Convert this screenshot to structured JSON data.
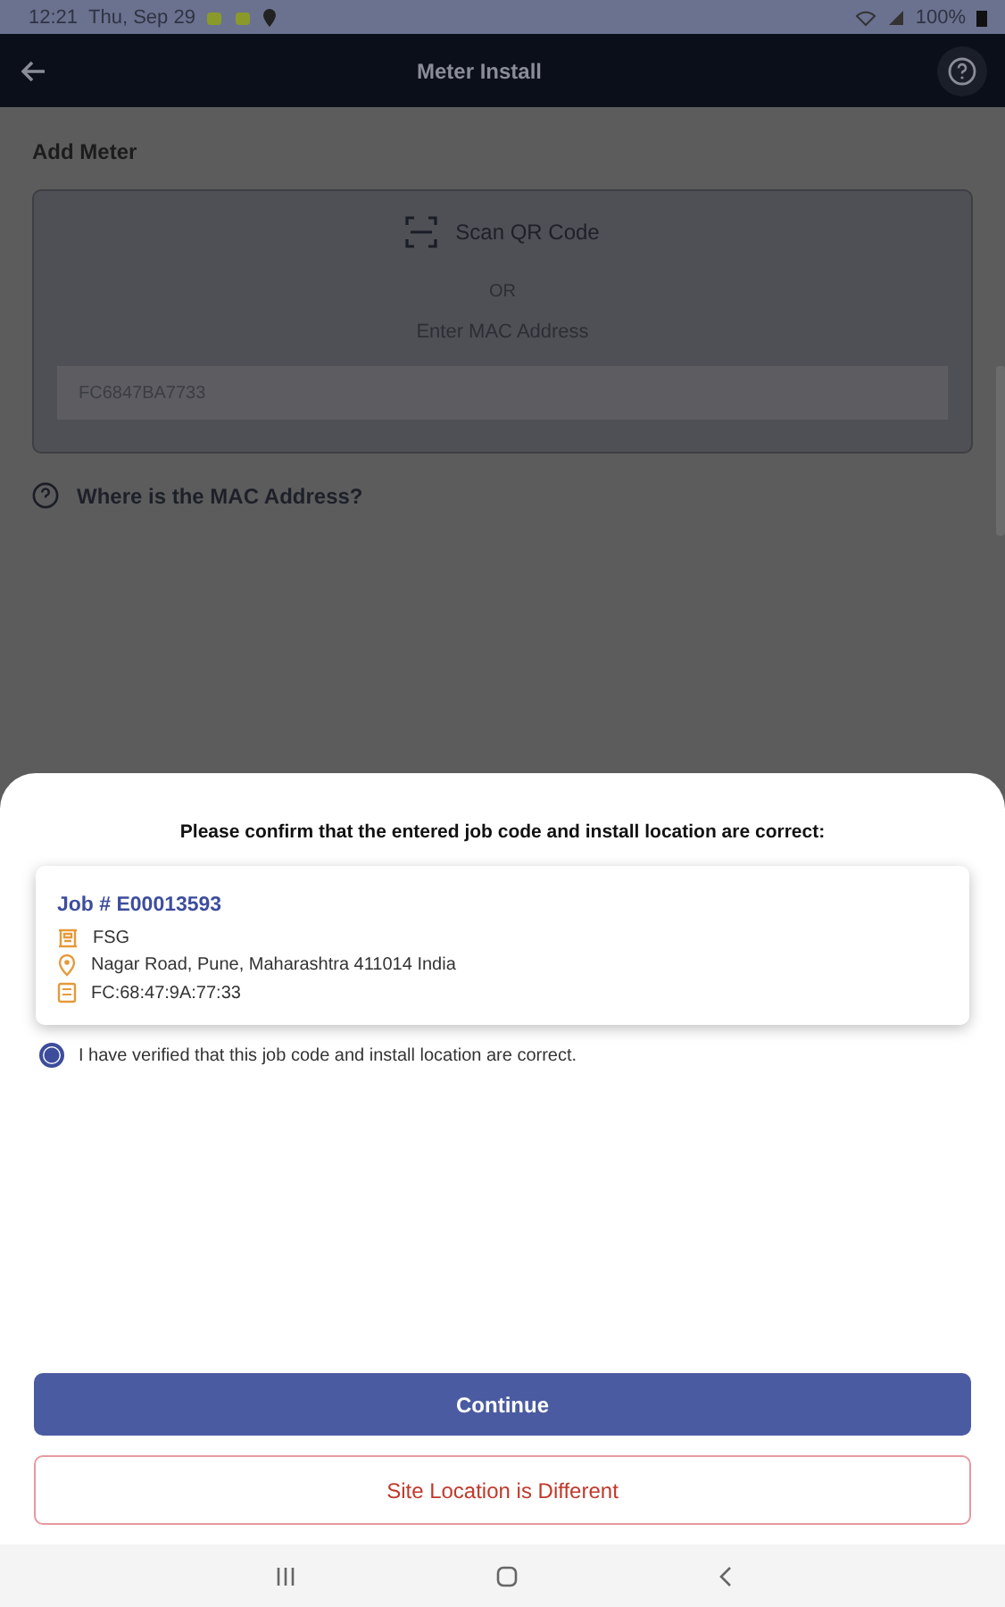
{
  "status_bar": {
    "time": "12:21",
    "date": "Thu, Sep 29",
    "battery": "100%"
  },
  "app_bar": {
    "title": "Meter Install"
  },
  "page": {
    "heading": "Add Meter",
    "scan_label": "Scan QR Code",
    "or": "OR",
    "enter_label": "Enter MAC Address",
    "mac_field": {
      "value": "FC6847BA7733"
    },
    "help_link": "Where is the MAC Address?"
  },
  "sheet": {
    "prompt": "Please confirm that the entered job code and install location are correct:",
    "job": {
      "title": "Job # E00013593",
      "details": [
        {
          "kind": "site",
          "text": "FSG"
        },
        {
          "kind": "location",
          "text": "Nagar Road, Pune, Maharashtra 411014 India"
        },
        {
          "kind": "meter",
          "text": "FC:68:47:9A:77:33"
        }
      ]
    },
    "confirm": {
      "label": "I have verified that this job code and install location are correct.",
      "selected": true
    },
    "buttons": [
      {
        "kind": "primary",
        "label": "Continue"
      },
      {
        "kind": "outline",
        "label": "Site Location is Different"
      }
    ]
  }
}
